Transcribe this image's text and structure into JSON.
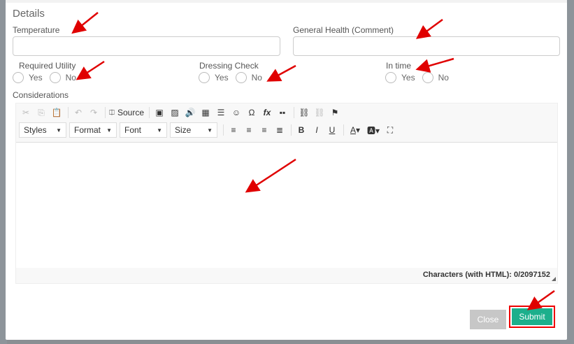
{
  "form": {
    "section_title": "Details",
    "temperature_label": "Temperature",
    "temperature_value": "",
    "health_label": "General Health (Comment)",
    "health_value": "",
    "required_utility_label": "Required Utility",
    "dressing_check_label": "Dressing Check",
    "in_time_label": "In time",
    "yes_label": "Yes",
    "no_label": "No",
    "considerations_label": "Considerations"
  },
  "editor": {
    "source_label": "Source",
    "styles_label": "Styles",
    "format_label": "Format",
    "font_label": "Font",
    "size_label": "Size",
    "status_text": "Characters (with HTML): 0/2097152"
  },
  "buttons": {
    "close_label": "Close",
    "submit_label": "Submit"
  },
  "colors": {
    "submit": "#1caf8c",
    "close": "#c7c7c7",
    "annotation": "#e00000"
  },
  "icons": [
    "cut-icon",
    "copy-icon",
    "paste-icon",
    "undo-icon",
    "redo-icon",
    "source-icon",
    "image-icon",
    "image2-icon",
    "audio-icon",
    "table-icon",
    "horizontal-line-icon",
    "smiley-icon",
    "special-char-icon",
    "formula-icon",
    "template-icon",
    "link-icon",
    "unlink-icon",
    "anchor-icon",
    "align-left-icon",
    "align-center-icon",
    "align-right-icon",
    "justify-icon",
    "bold-icon",
    "italic-icon",
    "underline-icon",
    "text-color-icon",
    "bg-color-icon",
    "maximize-icon"
  ]
}
